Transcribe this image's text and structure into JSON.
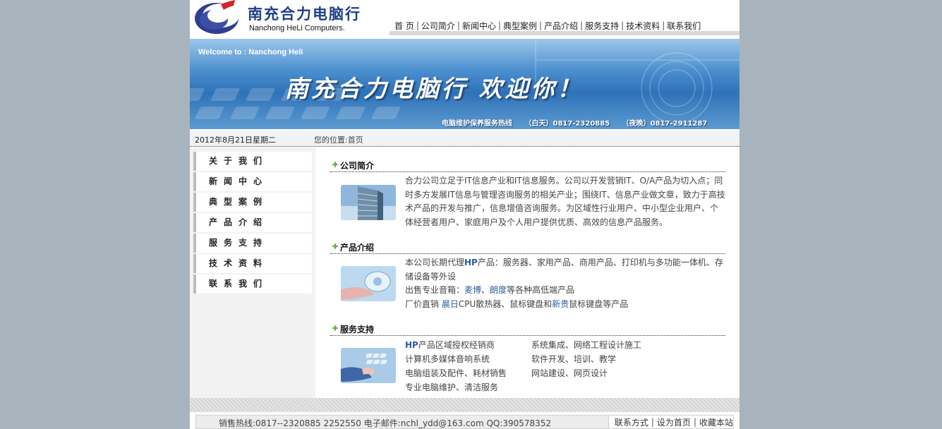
{
  "header": {
    "logo_cn": "南充合力电脑行",
    "logo_en": "Nanchong HeLi Computers.",
    "nav": [
      "首 页",
      "公司简介",
      "新闻中心",
      "典型案例",
      "产品介绍",
      "服务支持",
      "技术资料",
      "联系我们"
    ]
  },
  "banner": {
    "welcome": "Welcome to : Nanchong Heli",
    "headline": "南充合力电脑行 欢迎你！",
    "hotline_label": "电脑维护保养服务热线",
    "hotline_day": "（白天）0817-2320885",
    "hotline_night": "（夜晚）0817-2911287"
  },
  "infobar": {
    "date": "2012年8月21日星期二",
    "location": "您的位置:首页"
  },
  "sidebar": {
    "items": [
      "关于我们",
      "新闻中心",
      "典型案例",
      "产品介绍",
      "服务支持",
      "技术资料",
      "联系我们"
    ]
  },
  "content": {
    "company": {
      "title": "公司简介",
      "text": "合力公司立足于IT信息产业和IT信息服务。公司以开发营销IT、O/A产品为切入点；同时多方发展IT信息与管理咨询服务的相关产业；围绕IT、信息产业做文章，致力于高技术产品的开发与推广，信息增值咨询服务。为区域性行业用户、中小型企业用户、个体经营者用户、家庭用户及个人用户提供优质、高效的信息产品服务。"
    },
    "products": {
      "title": "产品介绍",
      "line1_a": "本公司长期代理",
      "line1_hp": "HP",
      "line1_b": "产品：服务器、家用产品、商用产品、打印机与多功能一体机、存储设备等外设",
      "line2_a": "出售专业音箱：",
      "line2_m1": "麦博",
      "line2_sep": "、",
      "line2_m2": "朗度",
      "line2_b": "等各种高低端产品",
      "line3_a": "厂价直销 ",
      "line3_m1": "晨日",
      "line3_b": "CPU散热器、鼠标键盘和",
      "line3_m2": "新贵",
      "line3_c": "鼠标键盘等产品"
    },
    "services": {
      "title": "服务支持",
      "col1_hp": "HP",
      "col1_first": "产品区域授权经销商",
      "col1": [
        "计算机多媒体音响系统",
        "电脑组装及配件、耗材销售",
        "专业电脑维护、清洁服务"
      ],
      "col2": [
        "系统集成、网络工程设计施工",
        "软件开发、培训、教学",
        "网站建设、网页设计"
      ]
    }
  },
  "footer": {
    "info": "销售热线:0817--2320885 2252550   电子邮件:nchl_ydd@163.com   QQ:390578352",
    "links": [
      "联系方式",
      "设为首页",
      "收藏本站"
    ]
  },
  "colors": {
    "page_bg": "#a8b4bd",
    "link_blue": "#2b5c9e",
    "logo_blue": "#1f3f86",
    "bullet_green": "#6fae3a"
  }
}
